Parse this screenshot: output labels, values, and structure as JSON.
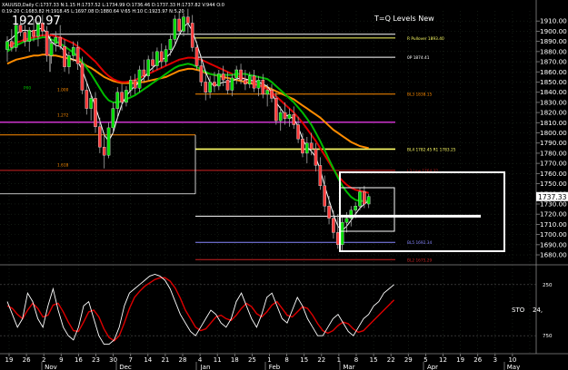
{
  "header": {
    "symbol_line": "XAUUSD,Daily  C:1737.33  N:1.15  H:1737.52  L:1734.99  O:1736.46  D:1737.33  H:1737.82  V:944  O:0",
    "info_line": "0:19-20  C:1683.82  H:1918.45  L:1697.08  D:1880.64  V:65  H:10  C:1923.97  N:5.20",
    "big_price": "1920.97",
    "indicator_title": "T=Q Levels New"
  },
  "chart_data": {
    "type": "candlestick",
    "title": "",
    "ylim": [
      1672,
      1920
    ],
    "y_ticks": [
      1910.0,
      1900.0,
      1890.0,
      1880.0,
      1870.0,
      1860.0,
      1850.0,
      1840.0,
      1830.0,
      1820.0,
      1810.0,
      1800.0,
      1790.0,
      1780.0,
      1770.0,
      1760.0,
      1750.0,
      1740.0,
      1730.0,
      1720.0,
      1710.0,
      1700.0,
      1690.0,
      1680.0
    ],
    "current_price": "1737.33",
    "x_tick_labels": [
      "19",
      "26",
      "2",
      "9",
      "16",
      "23",
      "30",
      "7",
      "14",
      "21",
      "28",
      "4",
      "11",
      "18",
      "25",
      "1",
      "8",
      "15",
      "22",
      "1",
      "8",
      "15",
      "22",
      "29",
      "5",
      "12",
      "19",
      "26",
      "3",
      "10"
    ],
    "month_labels": [
      "Nov",
      "Dec",
      "Jan",
      "Feb",
      "Mar",
      "Apr",
      "May"
    ],
    "candles": [
      {
        "o": 1882,
        "h": 1895,
        "l": 1870,
        "c": 1890
      },
      {
        "o": 1890,
        "h": 1902,
        "l": 1880,
        "c": 1884
      },
      {
        "o": 1884,
        "h": 1910,
        "l": 1880,
        "c": 1906
      },
      {
        "o": 1906,
        "h": 1914,
        "l": 1895,
        "c": 1899
      },
      {
        "o": 1899,
        "h": 1906,
        "l": 1885,
        "c": 1890
      },
      {
        "o": 1890,
        "h": 1904,
        "l": 1880,
        "c": 1901
      },
      {
        "o": 1901,
        "h": 1912,
        "l": 1890,
        "c": 1895
      },
      {
        "o": 1895,
        "h": 1910,
        "l": 1885,
        "c": 1908
      },
      {
        "o": 1908,
        "h": 1916,
        "l": 1895,
        "c": 1900
      },
      {
        "o": 1900,
        "h": 1905,
        "l": 1870,
        "c": 1876
      },
      {
        "o": 1876,
        "h": 1892,
        "l": 1868,
        "c": 1888
      },
      {
        "o": 1888,
        "h": 1900,
        "l": 1880,
        "c": 1894
      },
      {
        "o": 1894,
        "h": 1906,
        "l": 1882,
        "c": 1885
      },
      {
        "o": 1885,
        "h": 1892,
        "l": 1860,
        "c": 1865
      },
      {
        "o": 1865,
        "h": 1880,
        "l": 1858,
        "c": 1876
      },
      {
        "o": 1876,
        "h": 1890,
        "l": 1870,
        "c": 1884
      },
      {
        "o": 1884,
        "h": 1890,
        "l": 1862,
        "c": 1868
      },
      {
        "o": 1868,
        "h": 1875,
        "l": 1838,
        "c": 1842
      },
      {
        "o": 1842,
        "h": 1850,
        "l": 1818,
        "c": 1824
      },
      {
        "o": 1824,
        "h": 1838,
        "l": 1812,
        "c": 1834
      },
      {
        "o": 1834,
        "h": 1840,
        "l": 1800,
        "c": 1806
      },
      {
        "o": 1806,
        "h": 1815,
        "l": 1780,
        "c": 1786
      },
      {
        "o": 1786,
        "h": 1800,
        "l": 1765,
        "c": 1778
      },
      {
        "o": 1778,
        "h": 1810,
        "l": 1775,
        "c": 1805
      },
      {
        "o": 1805,
        "h": 1830,
        "l": 1800,
        "c": 1824
      },
      {
        "o": 1824,
        "h": 1845,
        "l": 1815,
        "c": 1840
      },
      {
        "o": 1840,
        "h": 1848,
        "l": 1822,
        "c": 1830
      },
      {
        "o": 1830,
        "h": 1846,
        "l": 1826,
        "c": 1842
      },
      {
        "o": 1842,
        "h": 1856,
        "l": 1836,
        "c": 1852
      },
      {
        "o": 1852,
        "h": 1858,
        "l": 1838,
        "c": 1844
      },
      {
        "o": 1844,
        "h": 1866,
        "l": 1840,
        "c": 1862
      },
      {
        "o": 1862,
        "h": 1872,
        "l": 1850,
        "c": 1856
      },
      {
        "o": 1856,
        "h": 1876,
        "l": 1852,
        "c": 1872
      },
      {
        "o": 1872,
        "h": 1880,
        "l": 1860,
        "c": 1866
      },
      {
        "o": 1866,
        "h": 1884,
        "l": 1862,
        "c": 1880
      },
      {
        "o": 1880,
        "h": 1888,
        "l": 1864,
        "c": 1870
      },
      {
        "o": 1870,
        "h": 1886,
        "l": 1866,
        "c": 1882
      },
      {
        "o": 1882,
        "h": 1896,
        "l": 1876,
        "c": 1892
      },
      {
        "o": 1892,
        "h": 1916,
        "l": 1888,
        "c": 1912
      },
      {
        "o": 1912,
        "h": 1920,
        "l": 1896,
        "c": 1900
      },
      {
        "o": 1900,
        "h": 1918,
        "l": 1895,
        "c": 1914
      },
      {
        "o": 1914,
        "h": 1922,
        "l": 1898,
        "c": 1908
      },
      {
        "o": 1908,
        "h": 1916,
        "l": 1880,
        "c": 1884
      },
      {
        "o": 1884,
        "h": 1890,
        "l": 1862,
        "c": 1866
      },
      {
        "o": 1866,
        "h": 1876,
        "l": 1846,
        "c": 1850
      },
      {
        "o": 1850,
        "h": 1858,
        "l": 1832,
        "c": 1840
      },
      {
        "o": 1840,
        "h": 1856,
        "l": 1834,
        "c": 1850
      },
      {
        "o": 1850,
        "h": 1860,
        "l": 1840,
        "c": 1846
      },
      {
        "o": 1846,
        "h": 1862,
        "l": 1842,
        "c": 1858
      },
      {
        "o": 1858,
        "h": 1866,
        "l": 1846,
        "c": 1852
      },
      {
        "o": 1852,
        "h": 1860,
        "l": 1838,
        "c": 1842
      },
      {
        "o": 1842,
        "h": 1858,
        "l": 1836,
        "c": 1854
      },
      {
        "o": 1854,
        "h": 1866,
        "l": 1848,
        "c": 1862
      },
      {
        "o": 1862,
        "h": 1868,
        "l": 1848,
        "c": 1852
      },
      {
        "o": 1852,
        "h": 1862,
        "l": 1842,
        "c": 1848
      },
      {
        "o": 1848,
        "h": 1860,
        "l": 1844,
        "c": 1856
      },
      {
        "o": 1856,
        "h": 1862,
        "l": 1840,
        "c": 1844
      },
      {
        "o": 1844,
        "h": 1856,
        "l": 1836,
        "c": 1852
      },
      {
        "o": 1852,
        "h": 1858,
        "l": 1834,
        "c": 1838
      },
      {
        "o": 1838,
        "h": 1848,
        "l": 1826,
        "c": 1842
      },
      {
        "o": 1842,
        "h": 1848,
        "l": 1830,
        "c": 1834
      },
      {
        "o": 1834,
        "h": 1840,
        "l": 1808,
        "c": 1812
      },
      {
        "o": 1812,
        "h": 1826,
        "l": 1802,
        "c": 1820
      },
      {
        "o": 1820,
        "h": 1830,
        "l": 1808,
        "c": 1814
      },
      {
        "o": 1814,
        "h": 1824,
        "l": 1806,
        "c": 1818
      },
      {
        "o": 1818,
        "h": 1826,
        "l": 1804,
        "c": 1808
      },
      {
        "o": 1808,
        "h": 1816,
        "l": 1790,
        "c": 1794
      },
      {
        "o": 1794,
        "h": 1800,
        "l": 1776,
        "c": 1780
      },
      {
        "o": 1780,
        "h": 1796,
        "l": 1770,
        "c": 1790
      },
      {
        "o": 1790,
        "h": 1800,
        "l": 1778,
        "c": 1784
      },
      {
        "o": 1784,
        "h": 1790,
        "l": 1762,
        "c": 1768
      },
      {
        "o": 1768,
        "h": 1776,
        "l": 1744,
        "c": 1748
      },
      {
        "o": 1748,
        "h": 1758,
        "l": 1722,
        "c": 1728
      },
      {
        "o": 1728,
        "h": 1738,
        "l": 1710,
        "c": 1716
      },
      {
        "o": 1716,
        "h": 1724,
        "l": 1696,
        "c": 1702
      },
      {
        "o": 1702,
        "h": 1720,
        "l": 1686,
        "c": 1690
      },
      {
        "o": 1690,
        "h": 1718,
        "l": 1684,
        "c": 1712
      },
      {
        "o": 1712,
        "h": 1722,
        "l": 1702,
        "c": 1716
      },
      {
        "o": 1716,
        "h": 1728,
        "l": 1708,
        "c": 1724
      },
      {
        "o": 1724,
        "h": 1732,
        "l": 1716,
        "c": 1728
      },
      {
        "o": 1728,
        "h": 1746,
        "l": 1724,
        "c": 1742
      },
      {
        "o": 1742,
        "h": 1748,
        "l": 1726,
        "c": 1730
      },
      {
        "o": 1730,
        "h": 1740,
        "l": 1726,
        "c": 1737.33
      }
    ],
    "ma_lines": [
      {
        "name": "",
        "color": "#ff8c00",
        "values": [
          1868,
          1870,
          1872,
          1873,
          1874,
          1875,
          1876,
          1876,
          1877,
          1877,
          1876,
          1876,
          1875,
          1874,
          1873,
          1872,
          1871,
          1869,
          1866,
          1864,
          1861,
          1858,
          1855,
          1853,
          1851,
          1850,
          1849,
          1849,
          1849,
          1849,
          1850,
          1850,
          1851,
          1852,
          1853,
          1854,
          1855,
          1857,
          1859,
          1861,
          1862,
          1863,
          1863,
          1862,
          1861,
          1859,
          1858,
          1857,
          1856,
          1855,
          1854,
          1853,
          1852,
          1851,
          1850,
          1849,
          1848,
          1847,
          1846,
          1845,
          1843,
          1841,
          1839,
          1837,
          1835,
          1833,
          1830,
          1827,
          1824,
          1821,
          1818,
          1815,
          1811,
          1807,
          1803,
          1800,
          1797,
          1794,
          1791,
          1789,
          1787,
          1786,
          1785
        ]
      },
      {
        "name": "",
        "color": "#dd0000",
        "values": [
          1885,
          1887,
          1889,
          1890,
          1892,
          1893,
          1894,
          1895,
          1896,
          1896,
          1896,
          1895,
          1894,
          1892,
          1890,
          1888,
          1885,
          1882,
          1878,
          1874,
          1870,
          1865,
          1860,
          1856,
          1853,
          1851,
          1850,
          1850,
          1851,
          1852,
          1854,
          1856,
          1858,
          1860,
          1862,
          1864,
          1866,
          1868,
          1870,
          1872,
          1873,
          1874,
          1874,
          1873,
          1872,
          1870,
          1868,
          1866,
          1864,
          1862,
          1860,
          1858,
          1856,
          1855,
          1853,
          1851,
          1849,
          1847,
          1845,
          1843,
          1840,
          1836,
          1832,
          1828,
          1824,
          1820,
          1815,
          1810,
          1804,
          1798,
          1792,
          1785,
          1778,
          1771,
          1764,
          1758,
          1753,
          1749,
          1746,
          1744,
          1743,
          1742,
          1741
        ]
      },
      {
        "name": "",
        "color": "#00bb00",
        "values": [
          1880,
          1883,
          1886,
          1888,
          1890,
          1891,
          1892,
          1893,
          1894,
          1894,
          1892,
          1890,
          1888,
          1885,
          1882,
          1879,
          1875,
          1870,
          1864,
          1858,
          1851,
          1844,
          1837,
          1832,
          1830,
          1830,
          1831,
          1833,
          1835,
          1837,
          1840,
          1843,
          1846,
          1849,
          1852,
          1855,
          1858,
          1861,
          1864,
          1866,
          1867,
          1868,
          1867,
          1865,
          1862,
          1860,
          1858,
          1857,
          1857,
          1857,
          1857,
          1857,
          1858,
          1858,
          1858,
          1857,
          1856,
          1855,
          1854,
          1853,
          1850,
          1846,
          1842,
          1838,
          1834,
          1830,
          1825,
          1820,
          1814,
          1808,
          1800,
          1792,
          1783,
          1774,
          1765,
          1756,
          1748,
          1742,
          1737,
          1734,
          1733,
          1733,
          1733
        ]
      },
      {
        "name": "",
        "color": "#ffffff",
        "values": [
          1890,
          1893,
          1897,
          1900,
          1901,
          1900,
          1900,
          1902,
          1903,
          1898,
          1890,
          1886,
          1885,
          1880,
          1874,
          1872,
          1870,
          1862,
          1850,
          1838,
          1826,
          1812,
          1798,
          1792,
          1800,
          1815,
          1828,
          1836,
          1842,
          1846,
          1850,
          1854,
          1860,
          1864,
          1868,
          1872,
          1874,
          1878,
          1886,
          1896,
          1904,
          1908,
          1900,
          1888,
          1874,
          1860,
          1850,
          1846,
          1848,
          1850,
          1850,
          1851,
          1853,
          1854,
          1853,
          1852,
          1851,
          1850,
          1848,
          1846,
          1840,
          1830,
          1824,
          1818,
          1816,
          1814,
          1806,
          1794,
          1786,
          1782,
          1776,
          1764,
          1748,
          1734,
          1720,
          1708,
          1704,
          1708,
          1714,
          1720,
          1726,
          1730,
          1733
        ]
      }
    ],
    "levels": [
      {
        "value": 1897,
        "color": "#ffffff",
        "label": ""
      },
      {
        "value": 1893.4,
        "color": "#ffff66",
        "label": "R Pullover 1893.40"
      },
      {
        "value": 1874.4,
        "color": "#ffffff",
        "label": "0P 1874.41"
      },
      {
        "value": 1838.2,
        "color": "#ff8c00",
        "label": "BL3 1838.15"
      },
      {
        "value": 1810.5,
        "color": "#cc33cc",
        "label": ""
      },
      {
        "value": 1784,
        "color": "#ffff66",
        "label": "BL4 1782.45  R1 1783.25"
      },
      {
        "value": 1763.1,
        "color": "#cc2222",
        "label": "L3 Low 1764.32"
      },
      {
        "value": 1718,
        "color": "#ffffff",
        "label": ""
      },
      {
        "value": 1692.3,
        "color": "#8888ff",
        "label": "BL5 1692.34"
      },
      {
        "value": 1675.3,
        "color": "#cc2222",
        "label": "BL2 1675.29"
      }
    ],
    "left_levels": [
      {
        "value": 1818,
        "label": "1.272"
      },
      {
        "value": 1769,
        "label": "1.618"
      },
      {
        "value": 1843,
        "label": "1.000"
      },
      {
        "value": 1843,
        "label": "P00"
      }
    ],
    "stochastic": {
      "label": "STO",
      "value_text": "24,",
      "levels": [
        "250",
        "750"
      ],
      "k": [
        60,
        45,
        30,
        40,
        70,
        60,
        40,
        30,
        55,
        75,
        50,
        30,
        20,
        15,
        30,
        55,
        60,
        40,
        20,
        10,
        10,
        15,
        30,
        55,
        70,
        75,
        80,
        85,
        90,
        92,
        90,
        85,
        75,
        60,
        45,
        35,
        25,
        20,
        30,
        40,
        50,
        45,
        35,
        30,
        40,
        60,
        70,
        55,
        40,
        30,
        45,
        65,
        70,
        55,
        40,
        35,
        50,
        65,
        55,
        40,
        30,
        20,
        20,
        30,
        40,
        45,
        35,
        25,
        20,
        30,
        40,
        45,
        55,
        60,
        70,
        75,
        80
      ],
      "d": [
        55,
        52,
        45,
        40,
        50,
        58,
        52,
        42,
        44,
        56,
        58,
        48,
        36,
        26,
        25,
        36,
        48,
        50,
        42,
        28,
        18,
        14,
        20,
        35,
        52,
        65,
        72,
        78,
        82,
        86,
        88,
        88,
        84,
        76,
        64,
        50,
        40,
        30,
        26,
        28,
        35,
        42,
        44,
        40,
        38,
        44,
        52,
        58,
        54,
        46,
        42,
        48,
        56,
        60,
        52,
        44,
        42,
        48,
        54,
        52,
        44,
        34,
        26,
        23,
        26,
        32,
        36,
        34,
        28,
        24,
        26,
        32,
        38,
        44,
        50,
        56,
        62
      ]
    }
  }
}
